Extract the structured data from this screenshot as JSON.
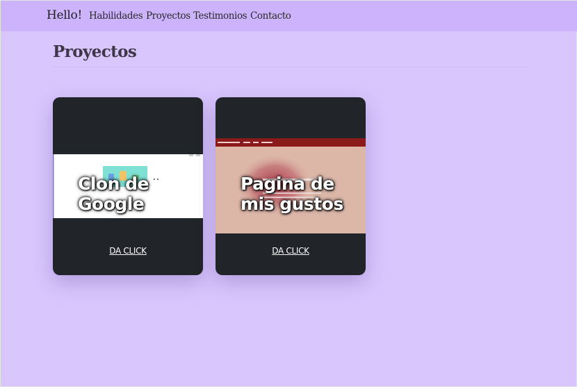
{
  "navbar": {
    "brand": "Hello!",
    "links": [
      "Habilidades",
      "Proyectos",
      "Testimonios",
      "Contacto"
    ]
  },
  "section": {
    "title": "Proyectos"
  },
  "projects": [
    {
      "title": "Clon de Google",
      "link_label": "DA CLICK"
    },
    {
      "title": "Pagina de mis gustos",
      "link_label": "DA CLICK"
    }
  ],
  "colors": {
    "page_bg": "#d9c6fd",
    "navbar_bg": "#cdb3fc",
    "card_bg": "#212529",
    "thumb_header": "#8b1a1a",
    "thumb_body": "#dcb7a8"
  }
}
